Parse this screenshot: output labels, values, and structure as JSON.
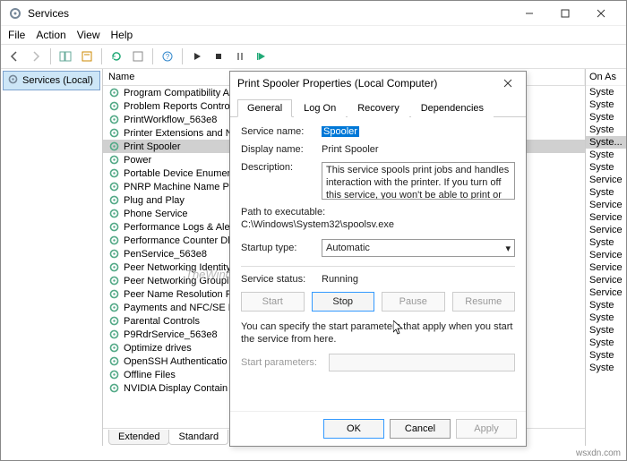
{
  "window": {
    "title": "Services",
    "menus": [
      "File",
      "Action",
      "View",
      "Help"
    ]
  },
  "left_pane": {
    "item": "Services (Local)"
  },
  "columns": {
    "name": "Name",
    "logonas": "On As"
  },
  "services": [
    {
      "name": "Program Compatibility A",
      "logon": "Syste"
    },
    {
      "name": "Problem Reports Contro",
      "logon": "Syste"
    },
    {
      "name": "PrintWorkflow_563e8",
      "logon": "Syste"
    },
    {
      "name": "Printer Extensions and N",
      "logon": "Syste"
    },
    {
      "name": "Print Spooler",
      "logon": "Syste...",
      "selected": true
    },
    {
      "name": "Power",
      "logon": "Syste"
    },
    {
      "name": "Portable Device Enumer",
      "logon": "Syste"
    },
    {
      "name": "PNRP Machine Name Pu",
      "logon": "Service"
    },
    {
      "name": "Plug and Play",
      "logon": "Syste"
    },
    {
      "name": "Phone Service",
      "logon": "Service"
    },
    {
      "name": "Performance Logs & Ale",
      "logon": "Service"
    },
    {
      "name": "Performance Counter Dl",
      "logon": "Service"
    },
    {
      "name": "PenService_563e8",
      "logon": "Syste"
    },
    {
      "name": "Peer Networking Identity",
      "logon": "Service"
    },
    {
      "name": "Peer Networking Groupi",
      "logon": "Service"
    },
    {
      "name": "Peer Name Resolution P",
      "logon": "Service"
    },
    {
      "name": "Payments and NFC/SE N",
      "logon": "Service"
    },
    {
      "name": "Parental Controls",
      "logon": "Syste"
    },
    {
      "name": "P9RdrService_563e8",
      "logon": "Syste"
    },
    {
      "name": "Optimize drives",
      "logon": "Syste"
    },
    {
      "name": "OpenSSH Authenticatio",
      "logon": "Syste"
    },
    {
      "name": "Offline Files",
      "logon": "Syste"
    },
    {
      "name": "NVIDIA Display Contain",
      "logon": "Syste"
    }
  ],
  "footer_tabs": {
    "extended": "Extended",
    "standard": "Standard"
  },
  "watermark": "TheWindowsClub",
  "dialog": {
    "title": "Print Spooler Properties (Local Computer)",
    "tabs": [
      "General",
      "Log On",
      "Recovery",
      "Dependencies"
    ],
    "active_tab": "General",
    "labels": {
      "service_name": "Service name:",
      "display_name": "Display name:",
      "description": "Description:",
      "path": "Path to executable:",
      "startup": "Startup type:",
      "status": "Service status:",
      "start_params": "Start parameters:"
    },
    "values": {
      "service_name": "Spooler",
      "display_name": "Print Spooler",
      "description": "This service spools print jobs and handles interaction with the printer.  If you turn off this service, you won't be able to print or see your printers.",
      "path": "C:\\Windows\\System32\\spoolsv.exe",
      "startup": "Automatic",
      "status": "Running"
    },
    "buttons": {
      "start": "Start",
      "stop": "Stop",
      "pause": "Pause",
      "resume": "Resume",
      "ok": "OK",
      "cancel": "Cancel",
      "apply": "Apply"
    },
    "note": "You can specify the start parameters that apply when you start the service from here."
  },
  "footer_url": "wsxdn.com"
}
